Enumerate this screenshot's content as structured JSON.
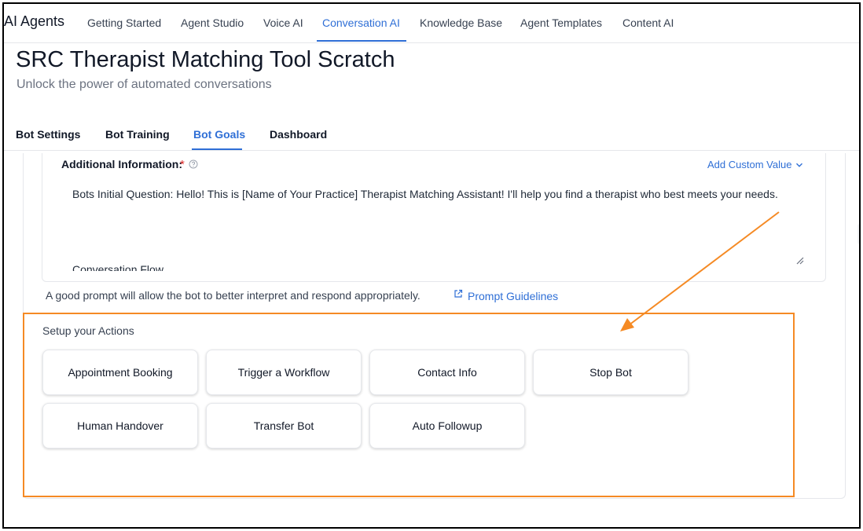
{
  "app": {
    "brand": "AI Agents"
  },
  "topnav": {
    "items": [
      {
        "label": "Getting Started"
      },
      {
        "label": "Agent Studio"
      },
      {
        "label": "Voice AI"
      },
      {
        "label": "Conversation AI",
        "active": true
      },
      {
        "label": "Knowledge Base"
      },
      {
        "label": "Agent Templates"
      },
      {
        "label": "Content AI"
      }
    ]
  },
  "page": {
    "title": "SRC Therapist Matching Tool Scratch",
    "subtitle": "Unlock the power of automated conversations"
  },
  "tabs": [
    {
      "label": "Bot Settings"
    },
    {
      "label": "Bot Training"
    },
    {
      "label": "Bot Goals",
      "active": true
    },
    {
      "label": "Dashboard"
    }
  ],
  "additional_info": {
    "label": "Additional Information:",
    "required_mark": "*",
    "add_custom_value": "Add Custom Value",
    "text": "Bots Initial Question: Hello! This is [Name of Your Practice] Therapist Matching Assistant! I'll help you find a therapist who best meets your needs.",
    "clipped_line": "Conversation Flow"
  },
  "hint": {
    "text": "A good prompt will allow the bot to better interpret and respond appropriately.",
    "link": "Prompt Guidelines"
  },
  "actions": {
    "title": "Setup your Actions",
    "buttons": [
      {
        "label": "Appointment Booking"
      },
      {
        "label": "Trigger a Workflow"
      },
      {
        "label": "Contact Info"
      },
      {
        "label": "Stop Bot"
      },
      {
        "label": "Human Handover"
      },
      {
        "label": "Transfer Bot"
      },
      {
        "label": "Auto Followup"
      }
    ]
  },
  "colors": {
    "accent": "#2f6fd6",
    "annotation": "#f58a24",
    "required": "#dc2626"
  },
  "icons": {
    "help": "question-circle-icon",
    "chevron": "chevron-down-icon",
    "external": "external-link-icon",
    "resize": "resize-handle-icon"
  }
}
